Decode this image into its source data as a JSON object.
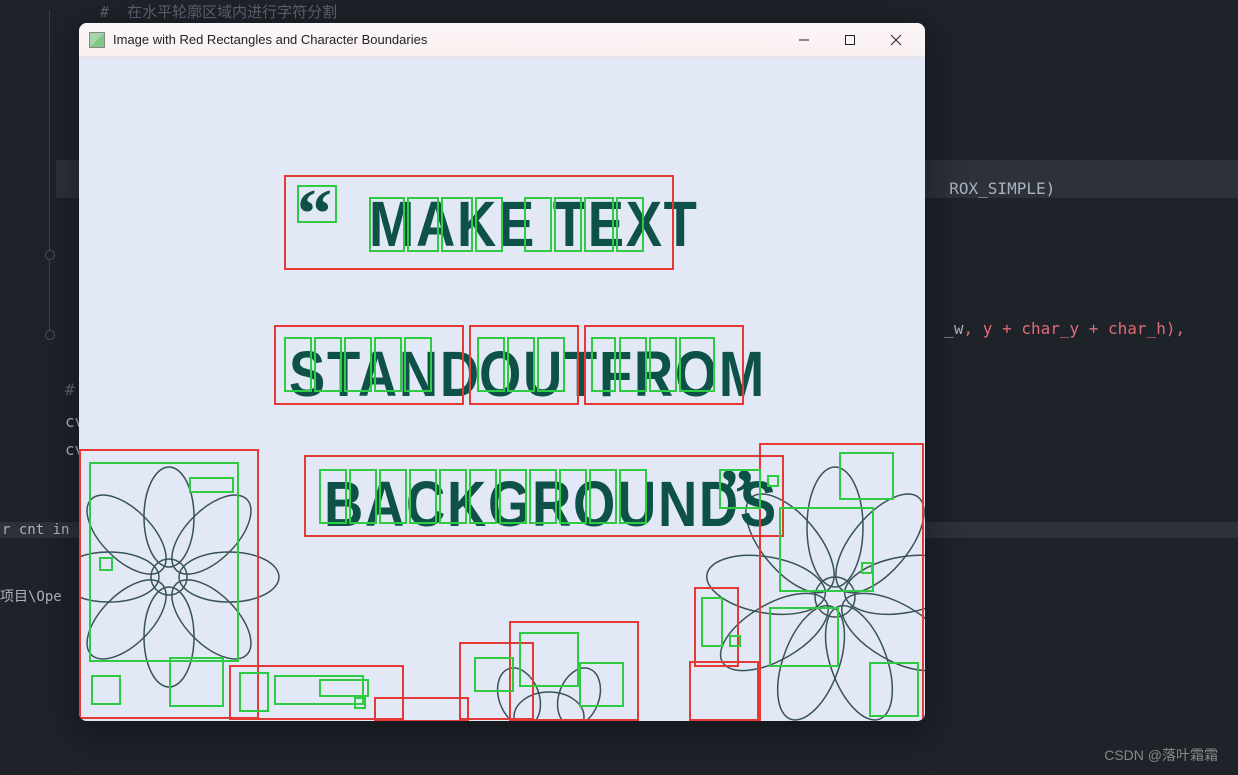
{
  "editor": {
    "comment1": "#  在水平轮廓区域内进行字符分割",
    "line_code1": "ROX_SIMPLE)",
    "line_code2_a": "_w",
    "line_code2_b": ", y + char_y + char_h),",
    "comment2": "# ",
    "cv_line1": "cv",
    "cv_line2": "cv",
    "term1": "r cnt in ho",
    "term2": "项目\\Ope"
  },
  "window": {
    "title": "Image with Red Rectangles and Character Boundaries"
  },
  "image": {
    "quote_open": "“",
    "line1": "MAKE TEXT",
    "line2a": "STAND",
    "line2b": "OUT",
    "line2c": "FROM",
    "line3": "BACKGROUNDS",
    "quote_close": "”"
  },
  "watermark": "CSDN @落叶霜霜"
}
